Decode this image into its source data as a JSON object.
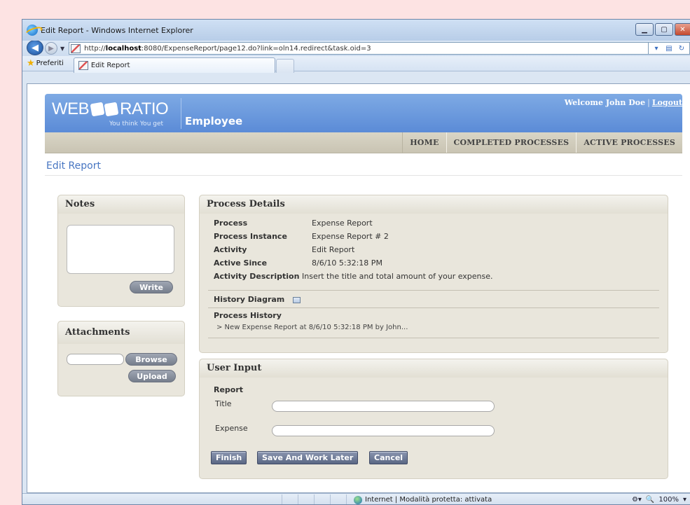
{
  "browser": {
    "window_title": "Edit Report - Windows Internet Explorer",
    "url_prefix": "http://",
    "url_host": "localhost",
    "url_rest": ":8080/ExpenseReport/page12.do?link=oln14.redirect&task.oid=3",
    "favorites_label": "Preferiti",
    "tab_label": "Edit Report",
    "status_zone": "Internet | Modalità protetta: attivata",
    "zoom": "100%"
  },
  "header": {
    "logo_text_1": "WEB",
    "logo_text_2": "RATIO",
    "logo_tagline": "You think You get",
    "app_title": "Employee",
    "welcome": "Welcome John Doe",
    "logout": "Logout"
  },
  "menu": {
    "items": [
      "HOME",
      "COMPLETED PROCESSES",
      "ACTIVE PROCESSES"
    ]
  },
  "page_title": "Edit Report",
  "notes": {
    "title": "Notes",
    "write_button": "Write",
    "text": ""
  },
  "attachments": {
    "title": "Attachments",
    "browse_button": "Browse",
    "upload_button": "Upload"
  },
  "process_details": {
    "title": "Process Details",
    "rows": [
      {
        "label": "Process",
        "value": "Expense Report"
      },
      {
        "label": "Process Instance",
        "value": "Expense Report # 2"
      },
      {
        "label": "Activity",
        "value": "Edit Report"
      },
      {
        "label": "Active Since",
        "value": "8/6/10 5:32:18 PM"
      },
      {
        "label": "Activity Description",
        "value": "Insert the title and total amount of your expense."
      }
    ],
    "history_diagram_label": "History Diagram",
    "process_history_label": "Process History",
    "history_entry": "> New Expense Report at 8/6/10 5:32:18 PM by John..."
  },
  "user_input": {
    "title": "User Input",
    "section": "Report",
    "title_label": "Title",
    "title_value": "",
    "expense_label": "Expense",
    "expense_value": "",
    "finish_button": "Finish",
    "save_button": "Save And Work Later",
    "cancel_button": "Cancel"
  }
}
